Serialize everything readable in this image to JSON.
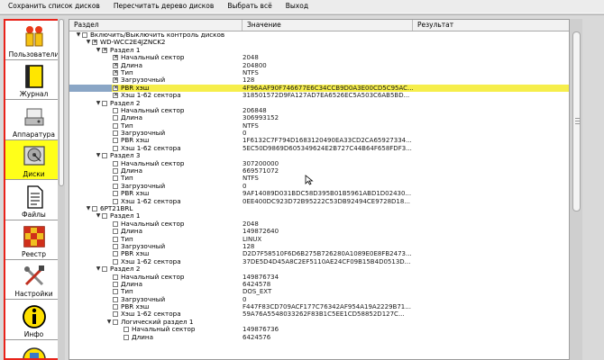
{
  "menu": [
    "Сохранить список дисков",
    "Пересчитать дерево дисков",
    "Выбрать всё",
    "Выход"
  ],
  "sidebar": [
    {
      "label": "Пользователи",
      "icon": "users-icon",
      "active": false
    },
    {
      "label": "Журнал",
      "icon": "journal-icon",
      "active": false
    },
    {
      "label": "Аппаратура",
      "icon": "hardware-icon",
      "active": false
    },
    {
      "label": "Диски",
      "icon": "disk-icon",
      "active": true
    },
    {
      "label": "Файлы",
      "icon": "files-icon",
      "active": false
    },
    {
      "label": "Реестр",
      "icon": "registry-icon",
      "active": false
    },
    {
      "label": "Настройки",
      "icon": "settings-icon",
      "active": false
    },
    {
      "label": "Инфо",
      "icon": "info-icon",
      "active": false
    }
  ],
  "table": {
    "columns": [
      "Раздел",
      "Значение",
      "Результат"
    ],
    "rows": [
      {
        "level": 0,
        "exp": "▼",
        "cb": false,
        "label": "Включить/Выключить контроль дисков",
        "value": ""
      },
      {
        "level": 1,
        "exp": "▼",
        "cb": true,
        "label": "WD-WCC2E4JZNCK2",
        "value": ""
      },
      {
        "level": 2,
        "exp": "▼",
        "cb": true,
        "label": "Раздел 1",
        "value": ""
      },
      {
        "level": 3,
        "exp": "",
        "cb": true,
        "label": "Начальный сектор",
        "value": "2048"
      },
      {
        "level": 3,
        "exp": "",
        "cb": true,
        "label": "Длина",
        "value": "204800"
      },
      {
        "level": 3,
        "exp": "",
        "cb": true,
        "label": "Тип",
        "value": "NTFS"
      },
      {
        "level": 3,
        "exp": "",
        "cb": true,
        "label": "Загрузочный",
        "value": "128"
      },
      {
        "level": 3,
        "exp": "",
        "cb": true,
        "label": "PBR хэш",
        "value": "4F96AAF90F746677E6C34CCB9D0A3E00CD5C95AC...",
        "selected": true
      },
      {
        "level": 3,
        "exp": "",
        "cb": true,
        "label": "Хэш 1-62 сектора",
        "value": "318501572D9FA127AD7EA6526EC5A503C6AB5BD..."
      },
      {
        "level": 2,
        "exp": "▼",
        "cb": false,
        "label": "Раздел 2",
        "value": ""
      },
      {
        "level": 3,
        "exp": "",
        "cb": false,
        "label": "Начальный сектор",
        "value": "206848"
      },
      {
        "level": 3,
        "exp": "",
        "cb": false,
        "label": "Длина",
        "value": "306993152"
      },
      {
        "level": 3,
        "exp": "",
        "cb": false,
        "label": "Тип",
        "value": "NTFS"
      },
      {
        "level": 3,
        "exp": "",
        "cb": false,
        "label": "Загрузочный",
        "value": "0"
      },
      {
        "level": 3,
        "exp": "",
        "cb": false,
        "label": "PBR хэш",
        "value": "1F6132C7F794D1683120490EA33CD2CA65927334..."
      },
      {
        "level": 3,
        "exp": "",
        "cb": false,
        "label": "Хэш 1-62 сектора",
        "value": "5EC50D9869D605349624E2B727C44B64F658FDF3..."
      },
      {
        "level": 2,
        "exp": "▼",
        "cb": false,
        "label": "Раздел 3",
        "value": ""
      },
      {
        "level": 3,
        "exp": "",
        "cb": false,
        "label": "Начальный сектор",
        "value": "307200000"
      },
      {
        "level": 3,
        "exp": "",
        "cb": false,
        "label": "Длина",
        "value": "669571072"
      },
      {
        "level": 3,
        "exp": "",
        "cb": false,
        "label": "Тип",
        "value": "NTFS"
      },
      {
        "level": 3,
        "exp": "",
        "cb": false,
        "label": "Загрузочный",
        "value": "0"
      },
      {
        "level": 3,
        "exp": "",
        "cb": false,
        "label": "PBR хэш",
        "value": "9AF14089D031BDC58D395B01B5961ABD1D02430..."
      },
      {
        "level": 3,
        "exp": "",
        "cb": false,
        "label": "Хэш 1-62 сектора",
        "value": "0EE400DC923D72B95222C53DB92494CE9728D18..."
      },
      {
        "level": 1,
        "exp": "▼",
        "cb": false,
        "label": "6PT21BRL",
        "value": ""
      },
      {
        "level": 2,
        "exp": "▼",
        "cb": false,
        "label": "Раздел 1",
        "value": ""
      },
      {
        "level": 3,
        "exp": "",
        "cb": false,
        "label": "Начальный сектор",
        "value": "2048"
      },
      {
        "level": 3,
        "exp": "",
        "cb": false,
        "label": "Длина",
        "value": "149872640"
      },
      {
        "level": 3,
        "exp": "",
        "cb": false,
        "label": "Тип",
        "value": "LINUX"
      },
      {
        "level": 3,
        "exp": "",
        "cb": false,
        "label": "Загрузочный",
        "value": "128"
      },
      {
        "level": 3,
        "exp": "",
        "cb": false,
        "label": "PBR хэш",
        "value": "D2D7F58510F6D6B275B726280A1089E0E8FB2473..."
      },
      {
        "level": 3,
        "exp": "",
        "cb": false,
        "label": "Хэш 1-62 сектора",
        "value": "37DE5D4D45A8C2EF5110AE24CF09B15B4D0513D..."
      },
      {
        "level": 2,
        "exp": "▼",
        "cb": false,
        "label": "Раздел 2",
        "value": ""
      },
      {
        "level": 3,
        "exp": "",
        "cb": false,
        "label": "Начальный сектор",
        "value": "149876734"
      },
      {
        "level": 3,
        "exp": "",
        "cb": false,
        "label": "Длина",
        "value": "6424578"
      },
      {
        "level": 3,
        "exp": "",
        "cb": false,
        "label": "Тип",
        "value": "DOS_EXT"
      },
      {
        "level": 3,
        "exp": "",
        "cb": false,
        "label": "Загрузочный",
        "value": "0"
      },
      {
        "level": 3,
        "exp": "",
        "cb": false,
        "label": "PBR хэш",
        "value": "F447F83CD709ACF177C76342AF954A19A2229B71..."
      },
      {
        "level": 3,
        "exp": "",
        "cb": false,
        "label": "Хэш 1-62 сектора",
        "value": "59A76A5548033262F83B1C5EE1CD58852D127C..."
      },
      {
        "level": 3,
        "exp": "▼",
        "cb": false,
        "label": "Логический раздел 1",
        "value": ""
      },
      {
        "level": 4,
        "exp": "",
        "cb": false,
        "label": "Начальный сектор",
        "value": "149876736"
      },
      {
        "level": 4,
        "exp": "",
        "cb": false,
        "label": "Длина",
        "value": "6424576"
      }
    ]
  }
}
